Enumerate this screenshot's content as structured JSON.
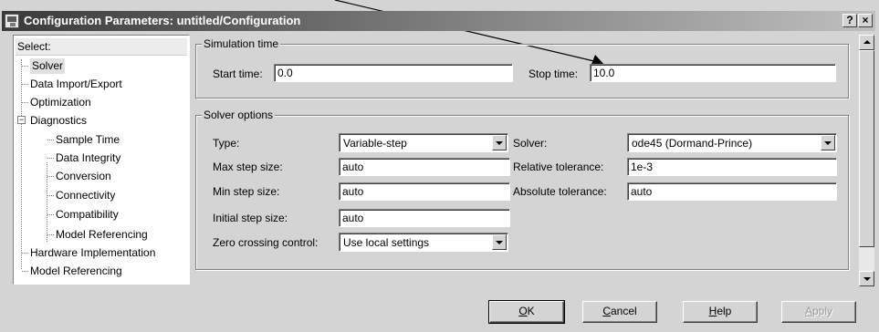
{
  "window": {
    "title": "Configuration Parameters: untitled/Configuration",
    "help_label": "?",
    "close_label": "×"
  },
  "tree": {
    "header": "Select:",
    "items": [
      {
        "label": "Solver",
        "selected": true
      },
      {
        "label": "Data Import/Export"
      },
      {
        "label": "Optimization"
      },
      {
        "label": "Diagnostics",
        "expander": "−"
      },
      {
        "label": "Sample Time"
      },
      {
        "label": "Data Integrity"
      },
      {
        "label": "Conversion"
      },
      {
        "label": "Connectivity"
      },
      {
        "label": "Compatibility"
      },
      {
        "label": "Model Referencing"
      },
      {
        "label": "Hardware Implementation"
      },
      {
        "label": "Model Referencing"
      }
    ]
  },
  "simulation_time": {
    "title": "Simulation time",
    "start_label": "Start time:",
    "start_value": "0.0",
    "stop_label": "Stop time:",
    "stop_value": "10.0"
  },
  "solver_options": {
    "title": "Solver options",
    "type_label": "Type:",
    "type_value": "Variable-step",
    "solver_label": "Solver:",
    "solver_value": "ode45 (Dormand-Prince)",
    "max_step_label": "Max step size:",
    "max_step_value": "auto",
    "rel_tol_label": "Relative tolerance:",
    "rel_tol_value": "1e-3",
    "min_step_label": "Min step size:",
    "min_step_value": "auto",
    "abs_tol_label": "Absolute tolerance:",
    "abs_tol_value": "auto",
    "init_step_label": "Initial step size:",
    "init_step_value": "auto",
    "zero_cross_label": "Zero crossing control:",
    "zero_cross_value": "Use local settings"
  },
  "buttons": {
    "ok_mnemonic": "O",
    "ok_rest": "K",
    "cancel_mnemonic": "C",
    "cancel_rest": "ancel",
    "help_mnemonic": "H",
    "help_rest": "elp",
    "apply_mnemonic": "A",
    "apply_rest": "pply"
  }
}
